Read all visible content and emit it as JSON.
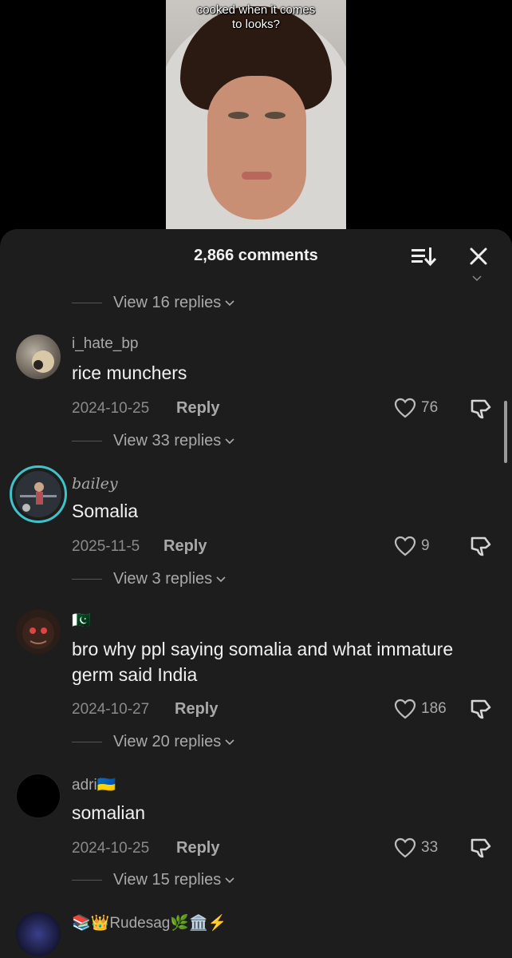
{
  "video": {
    "caption_line1": "cooked when it comes",
    "caption_line2": "to looks?"
  },
  "header": {
    "title": "2,866 comments"
  },
  "comments": [
    {
      "pre_replies": "View 16 replies",
      "username": "i_hate_bp",
      "text": "rice munchers",
      "date": "2024-10-25",
      "reply_label": "Reply",
      "likes": "76",
      "replies": "View 33 replies"
    },
    {
      "username": "bailey",
      "text": "Somalia",
      "date": "2025-11-5",
      "reply_label": "Reply",
      "likes": "9",
      "replies": "View 3 replies"
    },
    {
      "username": "🇵🇰",
      "text_line1": "bro why ppl saying somalia and what immature",
      "text_line2": "germ said India",
      "date": "2024-10-27",
      "reply_label": "Reply",
      "likes": "186",
      "replies": "View 20 replies"
    },
    {
      "username": "adri🇺🇦",
      "text": "somalian",
      "date": "2024-10-25",
      "reply_label": "Reply",
      "likes": "33",
      "replies": "View 15 replies"
    },
    {
      "username": "📚👑Rudesag🌿🏛️⚡️"
    }
  ]
}
